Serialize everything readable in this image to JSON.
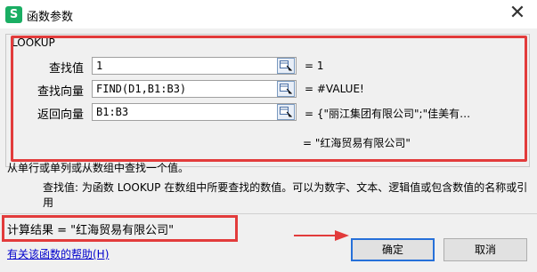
{
  "window": {
    "title": "函数参数",
    "app_icon_letter": "S",
    "close_glyph": "✕"
  },
  "function": {
    "name": "LOOKUP",
    "args": [
      {
        "label": "查找值",
        "value": "1",
        "result": "= 1"
      },
      {
        "label": "查找向量",
        "value": "FIND(D1,B1:B3)",
        "result": "= #VALUE!"
      },
      {
        "label": "返回向量",
        "value": "B1:B3",
        "result": "= {\"丽江集团有限公司\";\"佳美有…"
      }
    ],
    "formula_result": "= \"红海贸易有限公司\""
  },
  "description": {
    "summary": "从单行或单列或从数组中查找一个值。",
    "arg_name": "查找值:",
    "arg_text": "为函数 LOOKUP 在数组中所要查找的数值。可以为数字、文本、逻辑值或包含数值的名称或引用"
  },
  "calc_result": "计算结果 = \"红海贸易有限公司\"",
  "help_link": "有关该函数的帮助(H)",
  "buttons": {
    "ok": "确定",
    "cancel": "取消"
  },
  "icons": [
    "app-s-icon",
    "close-icon",
    "range-select-icon",
    "red-arrow-icon"
  ],
  "colors": {
    "highlight": "#e23b3b",
    "ok_border": "#2670d9",
    "link": "#0000cc",
    "app_green": "#1aae63"
  }
}
